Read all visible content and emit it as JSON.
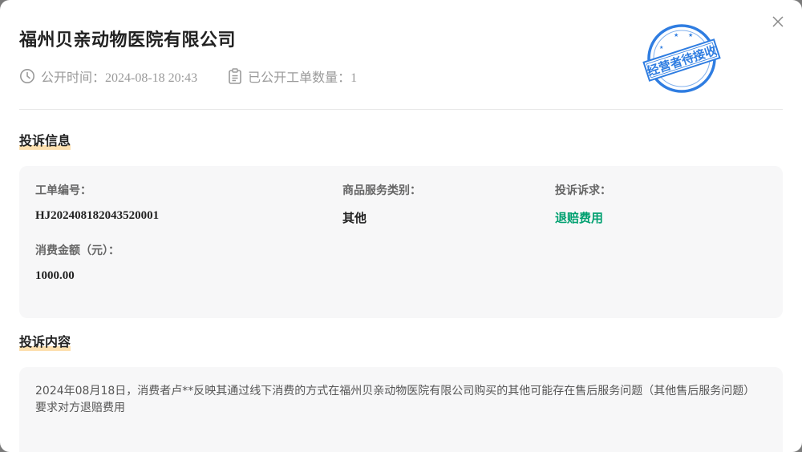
{
  "modal": {
    "title": "福州贝亲动物医院有限公司",
    "publish_time": "公开时间：2024-08-18 20:43",
    "ticket_count": "已公开工单数量：1",
    "stamp_text": "经营者待接收",
    "close_icon": "close-icon"
  },
  "complaint_info": {
    "section_title": "投诉信息",
    "ticket_no_label": "工单编号：",
    "ticket_no_value": "HJ202408182043520001",
    "category_label": "商品服务类别：",
    "category_value": "其他",
    "demand_label": "投诉诉求：",
    "demand_value": "退赔费用",
    "amount_label": "消费金额（元）：",
    "amount_value": "1000.00"
  },
  "complaint_content": {
    "section_title": "投诉内容",
    "text": "2024年08月18日，消费者卢**反映其通过线下消费的方式在福州贝亲动物医院有限公司购买的其他可能存在售后服务问题（其他售后服务问题）要求对方退赔费用"
  },
  "colors": {
    "accent_green": "#00a070",
    "stamp_blue": "#2f7de1",
    "underline_orange": "#fde0b0"
  }
}
